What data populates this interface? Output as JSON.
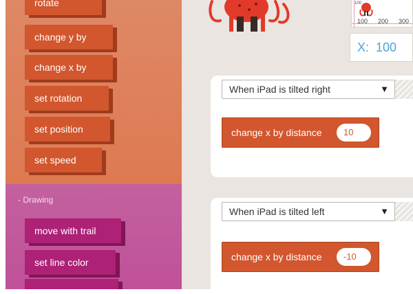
{
  "sidebar": {
    "motion_blocks": [
      {
        "label": "rotate"
      },
      {
        "label": "change y by"
      },
      {
        "label": "change x by"
      },
      {
        "label": "set rotation"
      },
      {
        "label": "set position"
      },
      {
        "label": "set speed"
      }
    ],
    "drawing_section_label": "- Drawing",
    "drawing_blocks": [
      {
        "label": "move with trail"
      },
      {
        "label": "set line color"
      },
      {
        "label": ""
      }
    ]
  },
  "stage": {
    "ticks": [
      "100",
      "200",
      "300"
    ],
    "tick_small": "100",
    "x_label": "X:",
    "x_value": "100"
  },
  "rules": [
    {
      "trigger": "When iPad is tilted right",
      "action_text": "change x by distance",
      "value": "10"
    },
    {
      "trigger": "When iPad is tilted left",
      "action_text": "change x by distance",
      "value": "-10"
    }
  ],
  "colors": {
    "motion_block": "#d2562e",
    "drawing_block": "#ad2176",
    "coordinate_text": "#4aa5d8",
    "sprite": "#e23a2a"
  },
  "icons": {
    "sprite": "octopus-sprite",
    "dropdown_arrow": "triangle-down"
  }
}
